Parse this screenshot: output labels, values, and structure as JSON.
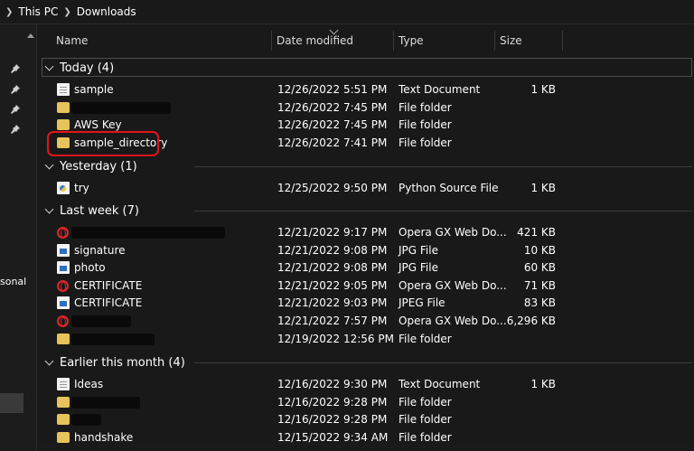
{
  "breadcrumb": [
    "This PC",
    "Downloads"
  ],
  "sidebar": {
    "partial_label": "sonal"
  },
  "columns": {
    "name": "Name",
    "date": "Date modified",
    "type": "Type",
    "size": "Size"
  },
  "colors": {
    "background": "#191919",
    "folder": "#e8c25a",
    "opera": "#e0262b",
    "highlight": "#e3141b"
  },
  "groups": [
    {
      "label": "Today (4)",
      "rows": [
        {
          "icon": "text-document-icon",
          "name": "sample",
          "date": "12/26/2022 5:51 PM",
          "type": "Text Document",
          "size": "1 KB"
        },
        {
          "icon": "folder-icon",
          "name": "",
          "redacted": true,
          "date": "12/26/2022 7:45 PM",
          "type": "File folder",
          "size": ""
        },
        {
          "icon": "folder-icon",
          "name": "AWS Key",
          "date": "12/26/2022 7:45 PM",
          "type": "File folder",
          "size": ""
        },
        {
          "icon": "folder-icon",
          "name": "sample_directory",
          "date": "12/26/2022 7:41 PM",
          "type": "File folder",
          "size": ""
        }
      ]
    },
    {
      "label": "Yesterday (1)",
      "rows": [
        {
          "icon": "python-file-icon",
          "name": "try",
          "date": "12/25/2022 9:50 PM",
          "type": "Python Source File",
          "size": "1 KB"
        }
      ]
    },
    {
      "label": "Last week (7)",
      "rows": [
        {
          "icon": "opera-icon",
          "name": "",
          "redacted": true,
          "date": "12/21/2022 9:17 PM",
          "type": "Opera GX Web Do...",
          "size": "421 KB"
        },
        {
          "icon": "jpg-file-icon",
          "name": "signature",
          "date": "12/21/2022 9:08 PM",
          "type": "JPG File",
          "size": "10 KB"
        },
        {
          "icon": "jpg-file-icon",
          "name": "photo",
          "date": "12/21/2022 9:08 PM",
          "type": "JPG File",
          "size": "60 KB"
        },
        {
          "icon": "opera-icon",
          "name": "CERTIFICATE",
          "date": "12/21/2022 9:05 PM",
          "type": "Opera GX Web Do...",
          "size": "71 KB"
        },
        {
          "icon": "jpg-file-icon",
          "name": "CERTIFICATE",
          "date": "12/21/2022 9:03 PM",
          "type": "JPEG File",
          "size": "83 KB"
        },
        {
          "icon": "opera-icon",
          "name": "",
          "redacted": true,
          "date": "12/21/2022 7:57 PM",
          "type": "Opera GX Web Do...",
          "size": "6,296 KB"
        },
        {
          "icon": "folder-icon",
          "name": "",
          "redacted": true,
          "date": "12/19/2022 12:56 PM",
          "type": "File folder",
          "size": ""
        }
      ]
    },
    {
      "label": "Earlier this month (4)",
      "rows": [
        {
          "icon": "text-document-icon",
          "name": "Ideas",
          "date": "12/16/2022 9:30 PM",
          "type": "Text Document",
          "size": "1 KB"
        },
        {
          "icon": "folder-icon",
          "name": "",
          "redacted": true,
          "date": "12/16/2022 9:28 PM",
          "type": "File folder",
          "size": ""
        },
        {
          "icon": "folder-icon",
          "name": "",
          "redacted": true,
          "date": "12/16/2022 9:28 PM",
          "type": "File folder",
          "size": ""
        },
        {
          "icon": "folder-icon",
          "name": "handshake",
          "date": "12/15/2022 9:34 AM",
          "type": "File folder",
          "size": ""
        }
      ]
    }
  ]
}
